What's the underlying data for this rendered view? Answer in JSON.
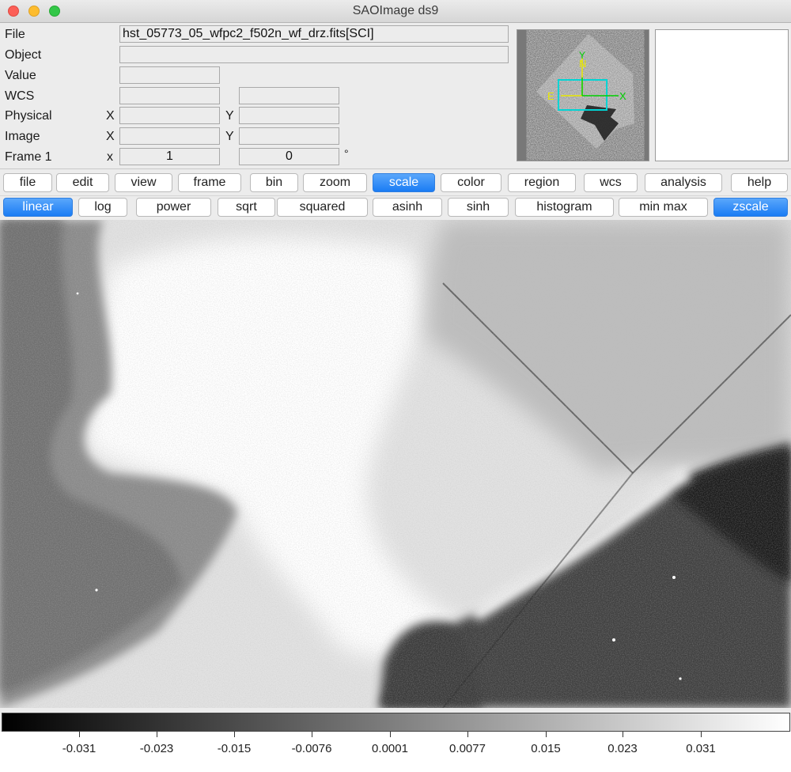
{
  "window": {
    "title": "SAOImage ds9"
  },
  "info": {
    "file_label": "File",
    "file_value": "hst_05773_05_wfpc2_f502n_wf_drz.fits[SCI]",
    "object_label": "Object",
    "object_value": "",
    "value_label": "Value",
    "value_value": "",
    "wcs_label": "WCS",
    "wcs_value1": "",
    "wcs_value2": "",
    "physical_label": "Physical",
    "physical_x_label": "X",
    "physical_y_label": "Y",
    "physical_x": "",
    "physical_y": "",
    "image_label": "Image",
    "image_x_label": "X",
    "image_y_label": "Y",
    "image_x": "",
    "image_y": "",
    "frame_label": "Frame 1",
    "frame_x_label": "x",
    "frame_zoom": "1",
    "frame_angle": "0",
    "frame_degree": "°"
  },
  "panner": {
    "north": "N",
    "east": "E",
    "y": "Y",
    "x": "X"
  },
  "menu": {
    "active": "scale",
    "items": [
      "file",
      "edit",
      "view",
      "frame",
      "bin",
      "zoom",
      "scale",
      "color",
      "region",
      "wcs",
      "analysis",
      "help"
    ]
  },
  "scale_buttons": {
    "active": [
      "linear",
      "zscale"
    ],
    "items": [
      "linear",
      "log",
      "power",
      "sqrt",
      "squared",
      "asinh",
      "sinh",
      "histogram",
      "min max",
      "zscale"
    ]
  },
  "colorbar": {
    "ticks": [
      "-0.031",
      "-0.023",
      "-0.015",
      "-0.0076",
      "0.0001",
      "0.0077",
      "0.015",
      "0.023",
      "0.031"
    ]
  },
  "colors": {
    "accent": "#1a7cf4",
    "panner_box": "#00d4d4",
    "panner_axis": "#e8e800",
    "panner_axis2": "#00d000"
  }
}
